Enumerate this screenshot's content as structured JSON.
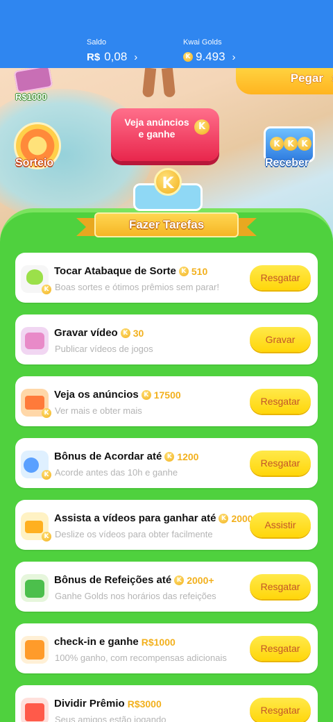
{
  "header": {
    "saldo_label": "Saldo",
    "saldo_currency": "R$",
    "saldo_value": "0,08",
    "golds_label": "Kwai Golds",
    "golds_value": "9.493",
    "chevron": "›"
  },
  "hero": {
    "money_label": "R$1000",
    "pegar_label": "Pegar",
    "sorteio_label": "Sorteio",
    "ad_button_label": "Veja anúncios e ganhe",
    "receber_label": "Receber"
  },
  "panel": {
    "ribbon_title": "Fazer Tarefas",
    "coin_glyph": "K"
  },
  "tasks": [
    {
      "title": "Tocar Atabaque de Sorte",
      "reward": "510",
      "reward_type": "coin",
      "desc": "Boas sortes e ótimos prêmios sem parar!",
      "button": "Resgatar",
      "icon": "drum-icon"
    },
    {
      "title": "Gravar vídeo",
      "reward": "30",
      "reward_type": "coin",
      "desc": "Publicar vídeos de jogos",
      "button": "Gravar",
      "icon": "record-video-icon"
    },
    {
      "title": "Veja os anúncios",
      "reward": "17500",
      "reward_type": "coin",
      "desc": "Ver mais e obter mais",
      "button": "Resgatar",
      "icon": "tv-ad-icon"
    },
    {
      "title": "Bônus de Acordar até",
      "reward": "1200",
      "reward_type": "coin",
      "desc": "Acorde antes das 10h e ganhe",
      "button": "Resgatar",
      "icon": "moon-icon"
    },
    {
      "title": "Assista a vídeos para ganhar até",
      "reward": "2000",
      "reward_type": "coin",
      "desc": "Deslize os vídeos para obter facilmente",
      "button": "Assistir",
      "icon": "camera-icon"
    },
    {
      "title": "Bônus de Refeições até",
      "reward": "2000+",
      "reward_type": "coin",
      "desc": "Ganhe Golds nos horários das refeições",
      "button": "Resgatar",
      "icon": "meal-icon"
    },
    {
      "title": "check-in e ganhe",
      "reward": "R$1000",
      "reward_type": "cash",
      "desc": "100% ganho, com recompensas adicionais",
      "button": "Resgatar",
      "icon": "calendar-365-icon"
    },
    {
      "title": "Dividir Prêmio",
      "reward": "R$3000",
      "reward_type": "cash",
      "desc": "Seus amigos estão jogando",
      "button": "Resgatar",
      "icon": "gift-icon"
    }
  ],
  "colors": {
    "top_bar": "#2f86f0",
    "panel_green": "#4fd13e",
    "button_yellow": "#ffd60a",
    "button_text": "#c2542a",
    "coin_gold": "#f2b01d"
  }
}
